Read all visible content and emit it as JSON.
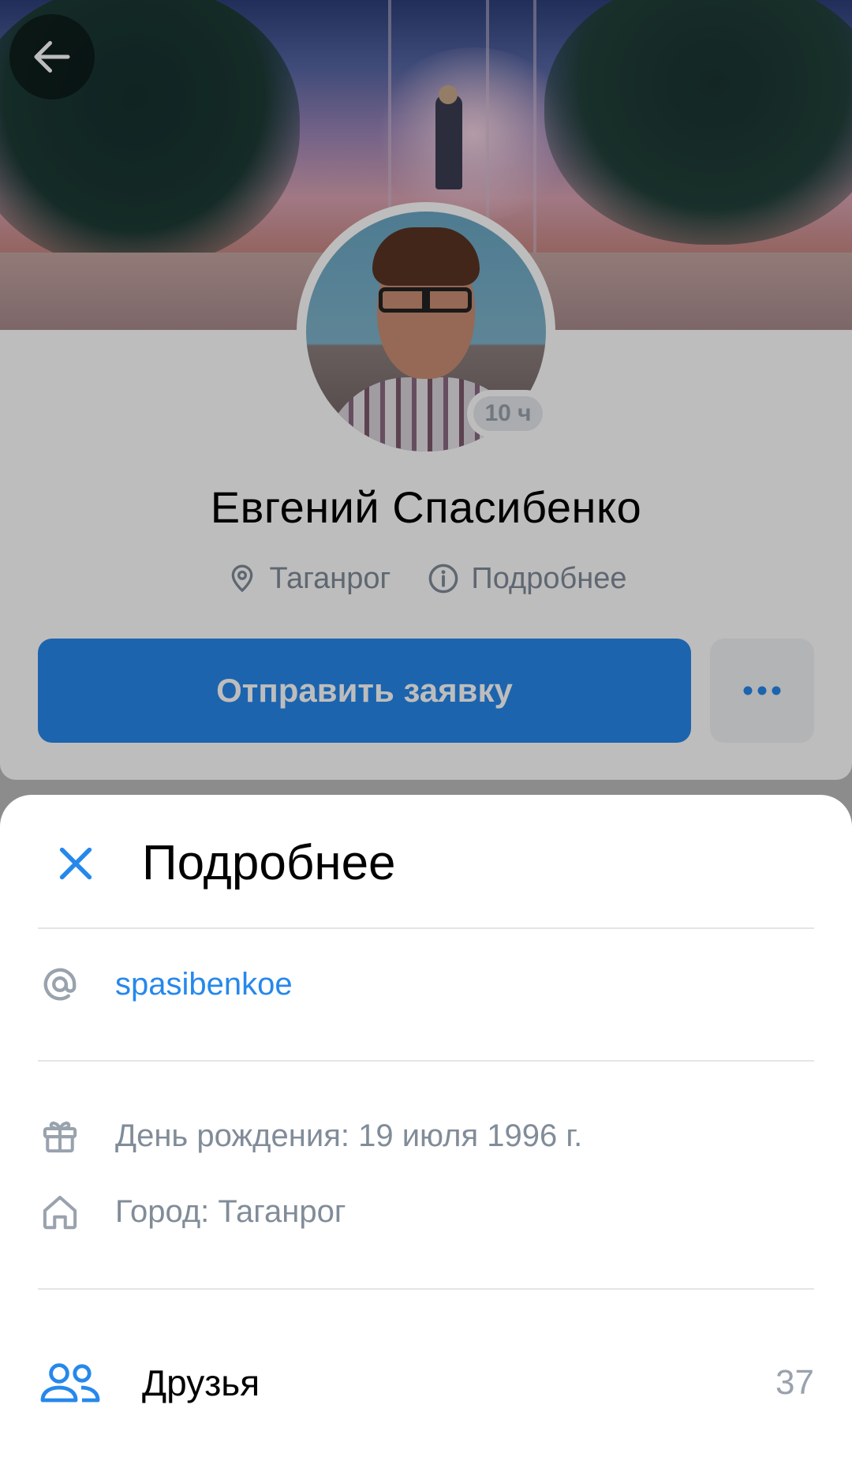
{
  "profile": {
    "name": "Евгений Спасибенко",
    "online_badge": "10 ч",
    "city": "Таганрог",
    "details_link": "Подробнее",
    "primary_button": "Отправить заявку"
  },
  "sheet": {
    "title": "Подробнее",
    "username": "spasibenkoe",
    "birthday": "День рождения: 19 июля 1996 г.",
    "city": "Город: Таганрог",
    "friends_label": "Друзья",
    "friends_count": "37"
  },
  "icons": {
    "back": "arrow-left-icon",
    "location": "location-pin-icon",
    "info": "info-icon",
    "more": "more-horizontal-icon",
    "close": "close-icon",
    "username": "at-sign-icon",
    "birthday": "gift-icon",
    "city": "home-icon",
    "friends": "users-icon"
  },
  "colors": {
    "accent": "#2688eb",
    "secondary_text": "#818c99",
    "primary_text": "#000000",
    "sheet_background": "#ffffff",
    "dim_overlay": "rgba(0,0,0,0.26)"
  }
}
